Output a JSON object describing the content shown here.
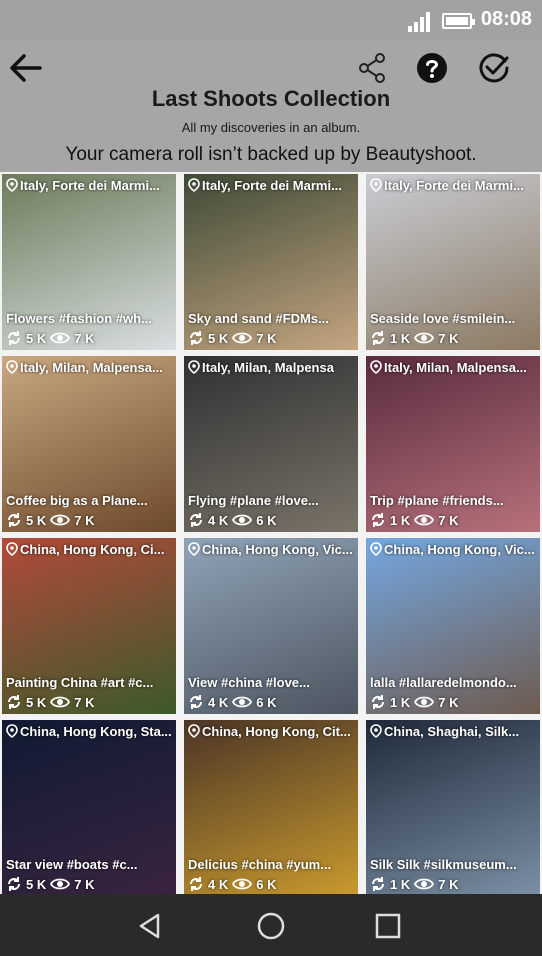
{
  "status_bar": {
    "time": "08:08"
  },
  "header": {
    "title": "Last Shoots Collection",
    "subtitle": "All my discoveries in an album.",
    "notice": "Your camera roll isn’t backed up by Beautyshoot."
  },
  "tiles": [
    {
      "location": "Italy, Forte dei Marmi...",
      "caption": "Flowers #fashion #wh...",
      "shares": "5 K",
      "views": "7 K",
      "palette": [
        "#6d7b5a",
        "#d9dfe1"
      ]
    },
    {
      "location": "Italy, Forte dei Marmi...",
      "caption": "Sky and sand #FDMs...",
      "shares": "5 K",
      "views": "7 K",
      "palette": [
        "#3f4a38",
        "#c4a580"
      ]
    },
    {
      "location": "Italy, Forte dei Marmi...",
      "caption": "Seaside love #smilein...",
      "shares": "1 K",
      "views": "7 K",
      "palette": [
        "#c9ccd3",
        "#8c7a63"
      ]
    },
    {
      "location": "Italy, Milan, Malpensa...",
      "caption": "Coffee big as a Plane...",
      "shares": "5 K",
      "views": "7 K",
      "palette": [
        "#c9a77f",
        "#6e4a2c"
      ]
    },
    {
      "location": "Italy, Milan, Malpensa",
      "caption": "Flying  #plane #love...",
      "shares": "4 K",
      "views": "6 K",
      "palette": [
        "#2f3132",
        "#7a7368"
      ]
    },
    {
      "location": "Italy, Milan, Malpensa...",
      "caption": "Trip #plane #friends...",
      "shares": "1 K",
      "views": "7 K",
      "palette": [
        "#5a2c3e",
        "#b6717a"
      ]
    },
    {
      "location": "China, Hong Kong, Ci...",
      "caption": "Painting China #art #c...",
      "shares": "5 K",
      "views": "7 K",
      "palette": [
        "#b24a3a",
        "#3c5a2a"
      ]
    },
    {
      "location": "China, Hong Kong, Vic...",
      "caption": "View #china #love...",
      "shares": "4 K",
      "views": "6 K",
      "palette": [
        "#8fa3b7",
        "#4d5560"
      ]
    },
    {
      "location": "China, Hong Kong, Vic...",
      "caption": "lalla #lallaredelmondo...",
      "shares": "1 K",
      "views": "7 K",
      "palette": [
        "#74a7e0",
        "#6e5b50"
      ]
    },
    {
      "location": "China, Hong Kong, Sta...",
      "caption": "Star view #boats #c...",
      "shares": "5 K",
      "views": "7 K",
      "palette": [
        "#0f1a33",
        "#3a2440"
      ]
    },
    {
      "location": "China, Hong Kong, Cit...",
      "caption": "Delicius #china #yum...",
      "shares": "4 K",
      "views": "6 K",
      "palette": [
        "#4b3526",
        "#c99a2e"
      ]
    },
    {
      "location": "China, Shaghai, Silk...",
      "caption": "Silk Silk #silkmuseum...",
      "shares": "1 K",
      "views": "7 K",
      "palette": [
        "#1e2a3a",
        "#7c8fa4"
      ]
    }
  ],
  "navigation": {
    "icons": [
      "back-triangle-icon",
      "home-circle-icon",
      "recents-square-icon"
    ]
  }
}
